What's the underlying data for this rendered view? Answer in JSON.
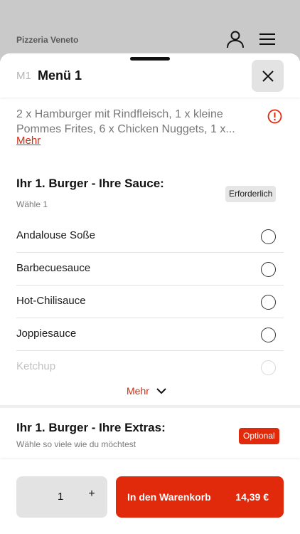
{
  "background": {
    "restaurant_name": "Pizzeria Veneto"
  },
  "sheet": {
    "code": "M1",
    "title": "Menü 1",
    "description_lines": [
      "2 x Hamburger mit Rindfleisch, 1 x kleine",
      "Pommes Frites, 6 x Chicken Nuggets, 1 x..."
    ],
    "more_link": "Mehr"
  },
  "sauce_section": {
    "title": "Ihr 1. Burger - Ihre Sauce:",
    "subtitle": "Wähle 1",
    "badge": "Erforderlich",
    "options": [
      {
        "label": "Andalouse Soße"
      },
      {
        "label": "Barbecuesauce"
      },
      {
        "label": "Hot-Chilisauce"
      },
      {
        "label": "Joppiesauce"
      },
      {
        "label": "Ketchup"
      }
    ],
    "more_toggle": "Mehr"
  },
  "extras_section": {
    "title": "Ihr 1. Burger - Ihre Extras:",
    "subtitle": "Wähle so viele wie du möchtest",
    "badge": "Optional"
  },
  "footer": {
    "quantity": "1",
    "plus": "+",
    "cart_label": "In den Warenkorb",
    "price": "14,39 €"
  },
  "colors": {
    "accent": "#e12a0c",
    "link": "#d12b10"
  }
}
